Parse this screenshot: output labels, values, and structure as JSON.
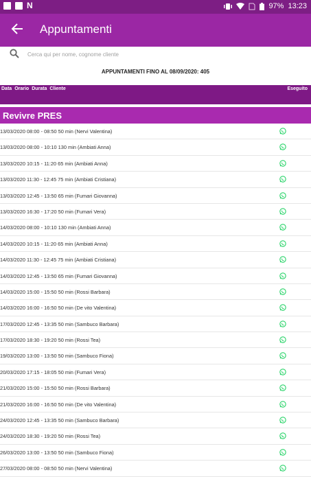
{
  "status_bar": {
    "battery": "97%",
    "time": "13:23"
  },
  "app_bar": {
    "title": "Appuntamenti"
  },
  "search": {
    "placeholder": "Cerca qui per nome, cognome cliente"
  },
  "summary": {
    "text": "APPUNTAMENTI FINO AL 08/09/2020: 405"
  },
  "columns": {
    "data": "Data",
    "orario": "Orario",
    "durata": "Durata",
    "cliente": "Cliente",
    "eseguito": "Eseguito"
  },
  "section": {
    "title": "Revivre PRES"
  },
  "appointments": [
    {
      "text": "13/03/2020 08:00 - 08:50  50 min (Nervi Valentina)",
      "action_icon": "whatsapp-icon"
    },
    {
      "text": "13/03/2020 08:00 - 10:10  130 min (Ambiati Anna)",
      "action_icon": "whatsapp-icon"
    },
    {
      "text": "13/03/2020 10:15 - 11:20  65 min (Ambiati Anna)",
      "action_icon": "whatsapp-icon"
    },
    {
      "text": "13/03/2020 11:30 - 12:45  75 min (Ambiati Cristiana)",
      "action_icon": "whatsapp-icon"
    },
    {
      "text": "13/03/2020 12:45 - 13:50  65 min (Fumari Giovanna)",
      "action_icon": "whatsapp-icon"
    },
    {
      "text": "13/03/2020 16:30 - 17:20  50 min (Fumari Vera)",
      "action_icon": "whatsapp-icon"
    },
    {
      "text": "14/03/2020 08:00 - 10:10  130 min (Ambiati Anna)",
      "action_icon": "whatsapp-icon"
    },
    {
      "text": "14/03/2020 10:15 - 11:20  65 min (Ambiati Anna)",
      "action_icon": "whatsapp-icon"
    },
    {
      "text": "14/03/2020 11:30 - 12:45  75 min (Ambiati Cristiana)",
      "action_icon": "whatsapp-icon"
    },
    {
      "text": "14/03/2020 12:45 - 13:50  65 min (Fumari Giovanna)",
      "action_icon": "whatsapp-icon"
    },
    {
      "text": "14/03/2020 15:00 - 15:50  50 min (Rossi Barbara)",
      "action_icon": "whatsapp-icon"
    },
    {
      "text": "14/03/2020 16:00 - 16:50  50 min (De vito Valentina)",
      "action_icon": "whatsapp-icon"
    },
    {
      "text": "17/03/2020 12:45 - 13:35  50 min (Sambuco Barbara)",
      "action_icon": "whatsapp-icon"
    },
    {
      "text": "17/03/2020 18:30 - 19:20  50 min (Rossi Tea)",
      "action_icon": "whatsapp-icon"
    },
    {
      "text": "19/03/2020 13:00 - 13:50  50 min (Sambuco Fiona)",
      "action_icon": "whatsapp-icon"
    },
    {
      "text": "20/03/2020 17:15 - 18:05  50 min (Fumari Vera)",
      "action_icon": "whatsapp-icon"
    },
    {
      "text": "21/03/2020 15:00 - 15:50  50 min (Rossi Barbara)",
      "action_icon": "whatsapp-icon"
    },
    {
      "text": "21/03/2020 16:00 - 16:50  50 min (De vito Valentina)",
      "action_icon": "whatsapp-icon"
    },
    {
      "text": "24/03/2020 12:45 - 13:35  50 min (Sambuco Barbara)",
      "action_icon": "whatsapp-icon"
    },
    {
      "text": "24/03/2020 18:30 - 19:20  50 min (Rossi Tea)",
      "action_icon": "whatsapp-icon"
    },
    {
      "text": "26/03/2020 13:00 - 13:50  50 min (Sambuco Fiona)",
      "action_icon": "whatsapp-icon"
    },
    {
      "text": "27/03/2020 08:00 - 08:50  50 min (Nervi Valentina)",
      "action_icon": "whatsapp-icon"
    }
  ],
  "colors": {
    "status_bar": "#7d1e84",
    "app_bar": "#9b27a4",
    "column_header": "#7e1985",
    "section": "#a92aaf",
    "whatsapp": "#25d366"
  }
}
